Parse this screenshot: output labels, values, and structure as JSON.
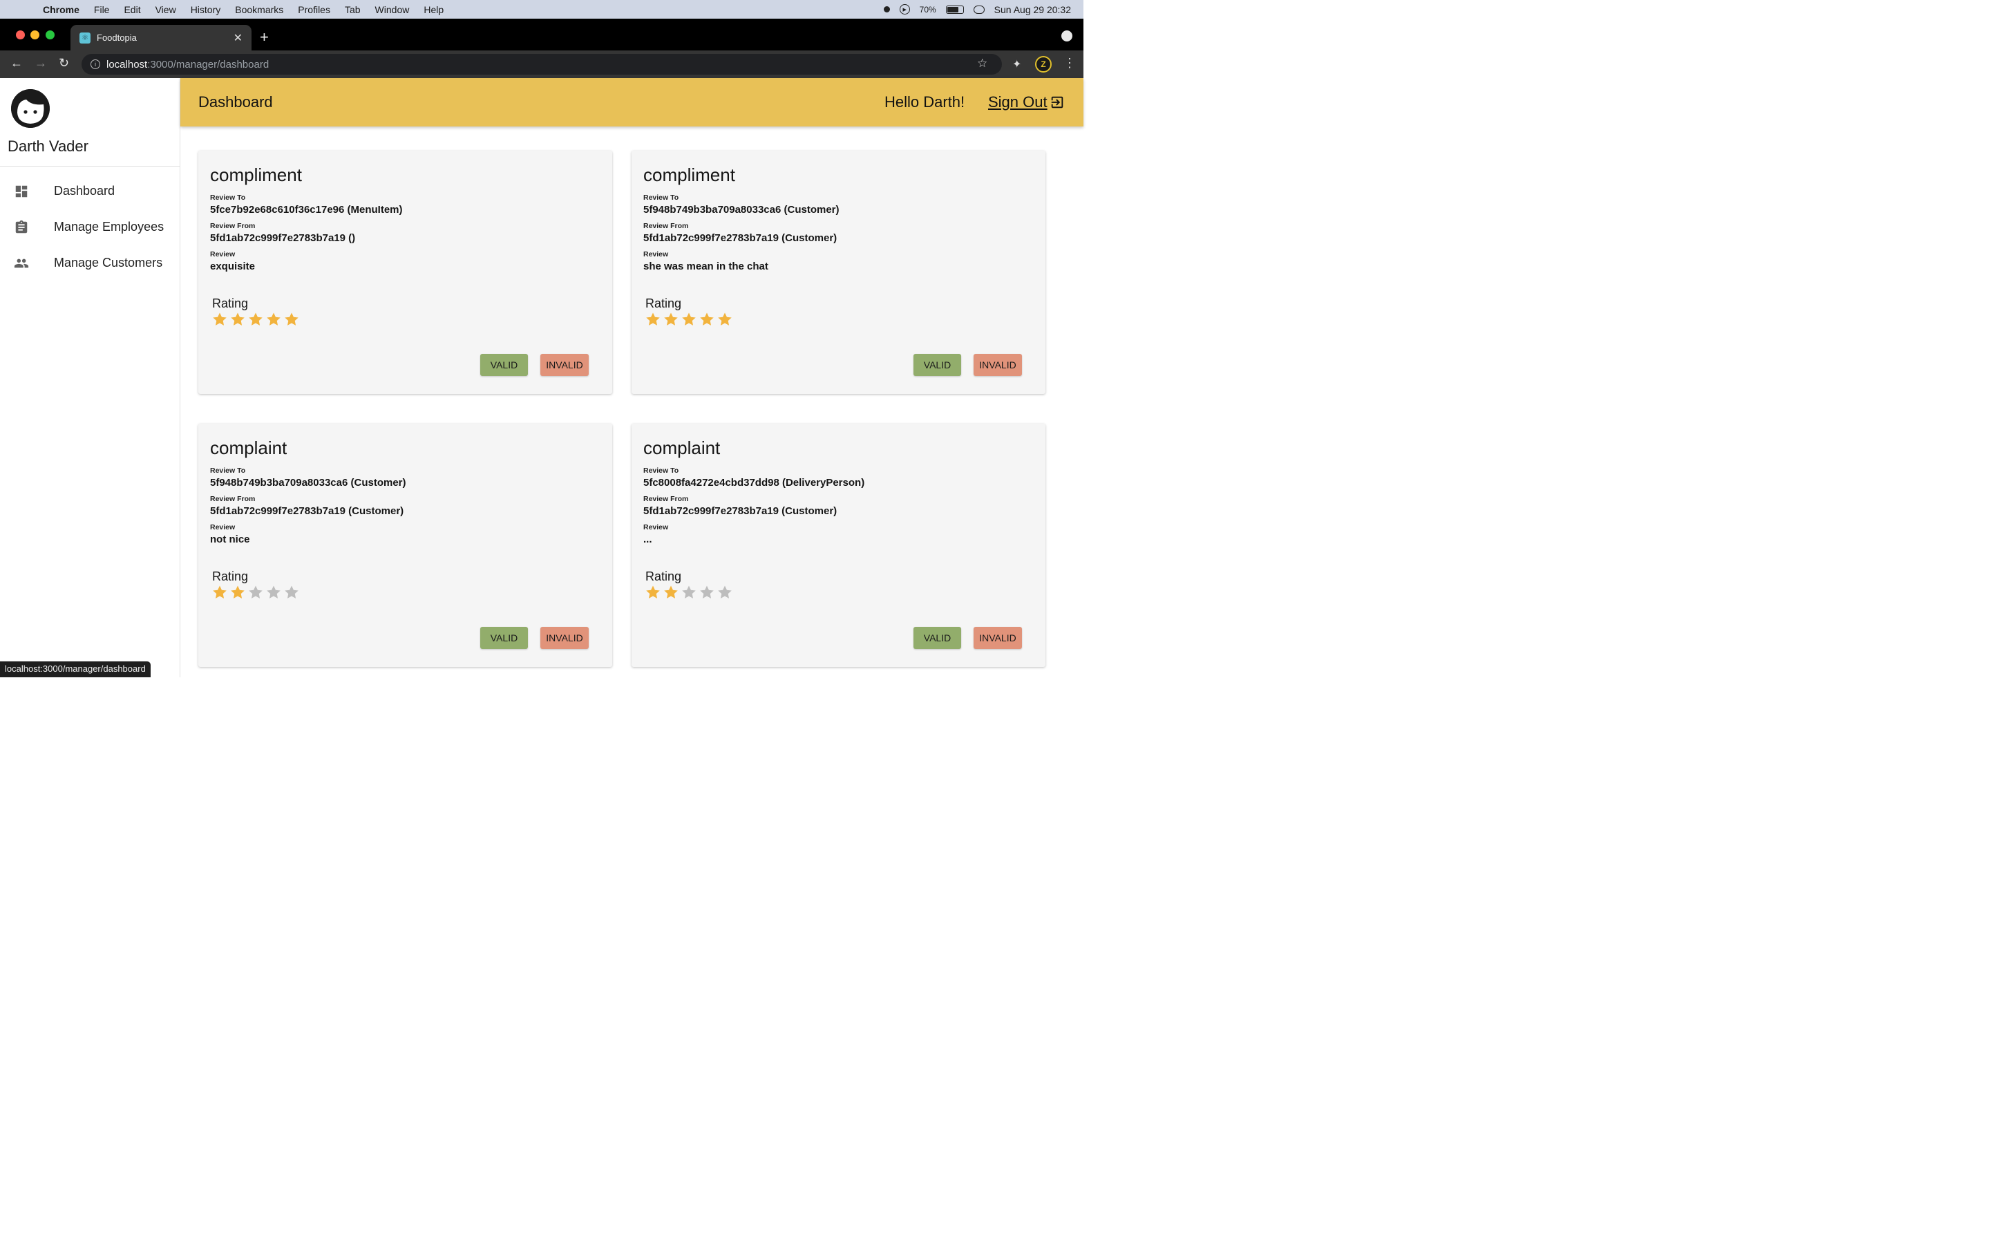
{
  "os_menubar": {
    "app": "Chrome",
    "menus": [
      "File",
      "Edit",
      "View",
      "History",
      "Bookmarks",
      "Profiles",
      "Tab",
      "Window",
      "Help"
    ],
    "battery": "70%",
    "datetime": "Sun Aug 29  20:32"
  },
  "browser": {
    "tab_title": "Foodtopia",
    "url_host": "localhost",
    "url_path": ":3000/manager/dashboard",
    "status_url": "localhost:3000/manager/dashboard",
    "profile_letter": "Z"
  },
  "sidebar": {
    "user_name": "Darth Vader",
    "items": [
      {
        "label": "Dashboard",
        "icon": "dashboard-icon"
      },
      {
        "label": "Manage Employees",
        "icon": "clipboard-icon"
      },
      {
        "label": "Manage Customers",
        "icon": "people-icon"
      }
    ]
  },
  "header": {
    "title": "Dashboard",
    "greeting": "Hello Darth!",
    "signout_label": "Sign Out"
  },
  "labels": {
    "review_to": "Review To",
    "review_from": "Review From",
    "review": "Review",
    "rating": "Rating",
    "valid": "VALID",
    "invalid": "INVALID"
  },
  "colors": {
    "header_bg": "#e8c157",
    "valid_btn": "#92ad6b",
    "invalid_btn": "#e1937a",
    "star_filled": "#f2b33d",
    "star_empty": "#bdbdbd"
  },
  "reviews": [
    {
      "type": "compliment",
      "review_to": "5fce7b92e68c610f36c17e96 (MenuItem)",
      "review_from": "5fd1ab72c999f7e2783b7a19 ()",
      "review": "exquisite",
      "rating": 5
    },
    {
      "type": "compliment",
      "review_to": "5f948b749b3ba709a8033ca6 (Customer)",
      "review_from": "5fd1ab72c999f7e2783b7a19 (Customer)",
      "review": "she was mean in the chat",
      "rating": 5
    },
    {
      "type": "complaint",
      "review_to": "5f948b749b3ba709a8033ca6 (Customer)",
      "review_from": "5fd1ab72c999f7e2783b7a19 (Customer)",
      "review": "not nice",
      "rating": 2
    },
    {
      "type": "complaint",
      "review_to": "5fc8008fa4272e4cbd37dd98 (DeliveryPerson)",
      "review_from": "5fd1ab72c999f7e2783b7a19 (Customer)",
      "review": "...",
      "rating": 2
    }
  ]
}
